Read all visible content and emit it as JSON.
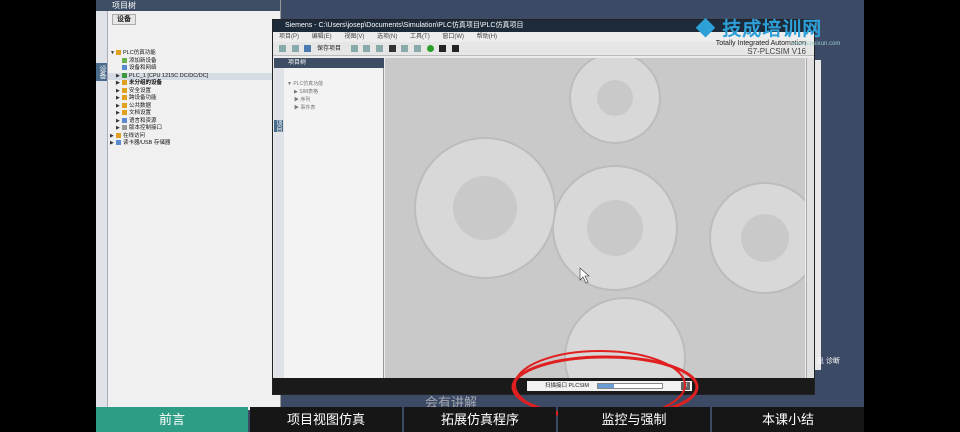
{
  "left_panel": {
    "title": "项目树",
    "side_label": "设备",
    "tab": "设备",
    "tree": [
      {
        "label": "PLC仿真功能",
        "level": 0
      },
      {
        "label": "添加新设备",
        "level": 1
      },
      {
        "label": "设备和网络",
        "level": 1
      },
      {
        "label": "PLC_1 [CPU 1215C DC/DC/DC]",
        "level": 1,
        "selected": true
      },
      {
        "label": "未分组的设备",
        "level": 1
      },
      {
        "label": "安全设置",
        "level": 1
      },
      {
        "label": "跨设备功能",
        "level": 1
      },
      {
        "label": "公共数据",
        "level": 1
      },
      {
        "label": "文档设置",
        "level": 1
      },
      {
        "label": "语言和资源",
        "level": 1
      },
      {
        "label": "版本控制接口",
        "level": 1
      },
      {
        "label": "在线访问",
        "level": 0
      },
      {
        "label": "读卡器/USB 存储器",
        "level": 0
      }
    ]
  },
  "simulator": {
    "title": "Siemens  -  C:\\Users\\josep\\Documents\\Simulation\\PLC仿真项目\\PLC仿真项目",
    "menu": [
      "项目(P)",
      "编辑(E)",
      "视图(V)",
      "选项(N)",
      "工具(T)",
      "窗口(W)",
      "帮助(H)"
    ],
    "save_label": "保存项目",
    "brand_line1": "Totally Integrated Automation",
    "brand_line2": "S7-PLCSIM V16",
    "project_tree_title": "项目树",
    "project_side_label": "项目",
    "project_tree": [
      "PLC仿真功能",
      "SIM表格",
      "序列",
      "事件表"
    ],
    "scan_label": "扫描接口 PLCSIM",
    "scan_progress": 0.25
  },
  "right_panel": {
    "label": "息 诊断"
  },
  "watermark": {
    "text": "技成培训网",
    "url": "www.jcpeixun.com"
  },
  "nav": {
    "items": [
      "前言",
      "项目视图仿真",
      "拓展仿真程序",
      "监控与强制",
      "本课小结"
    ],
    "active": 0
  },
  "caption": "会有讲解"
}
